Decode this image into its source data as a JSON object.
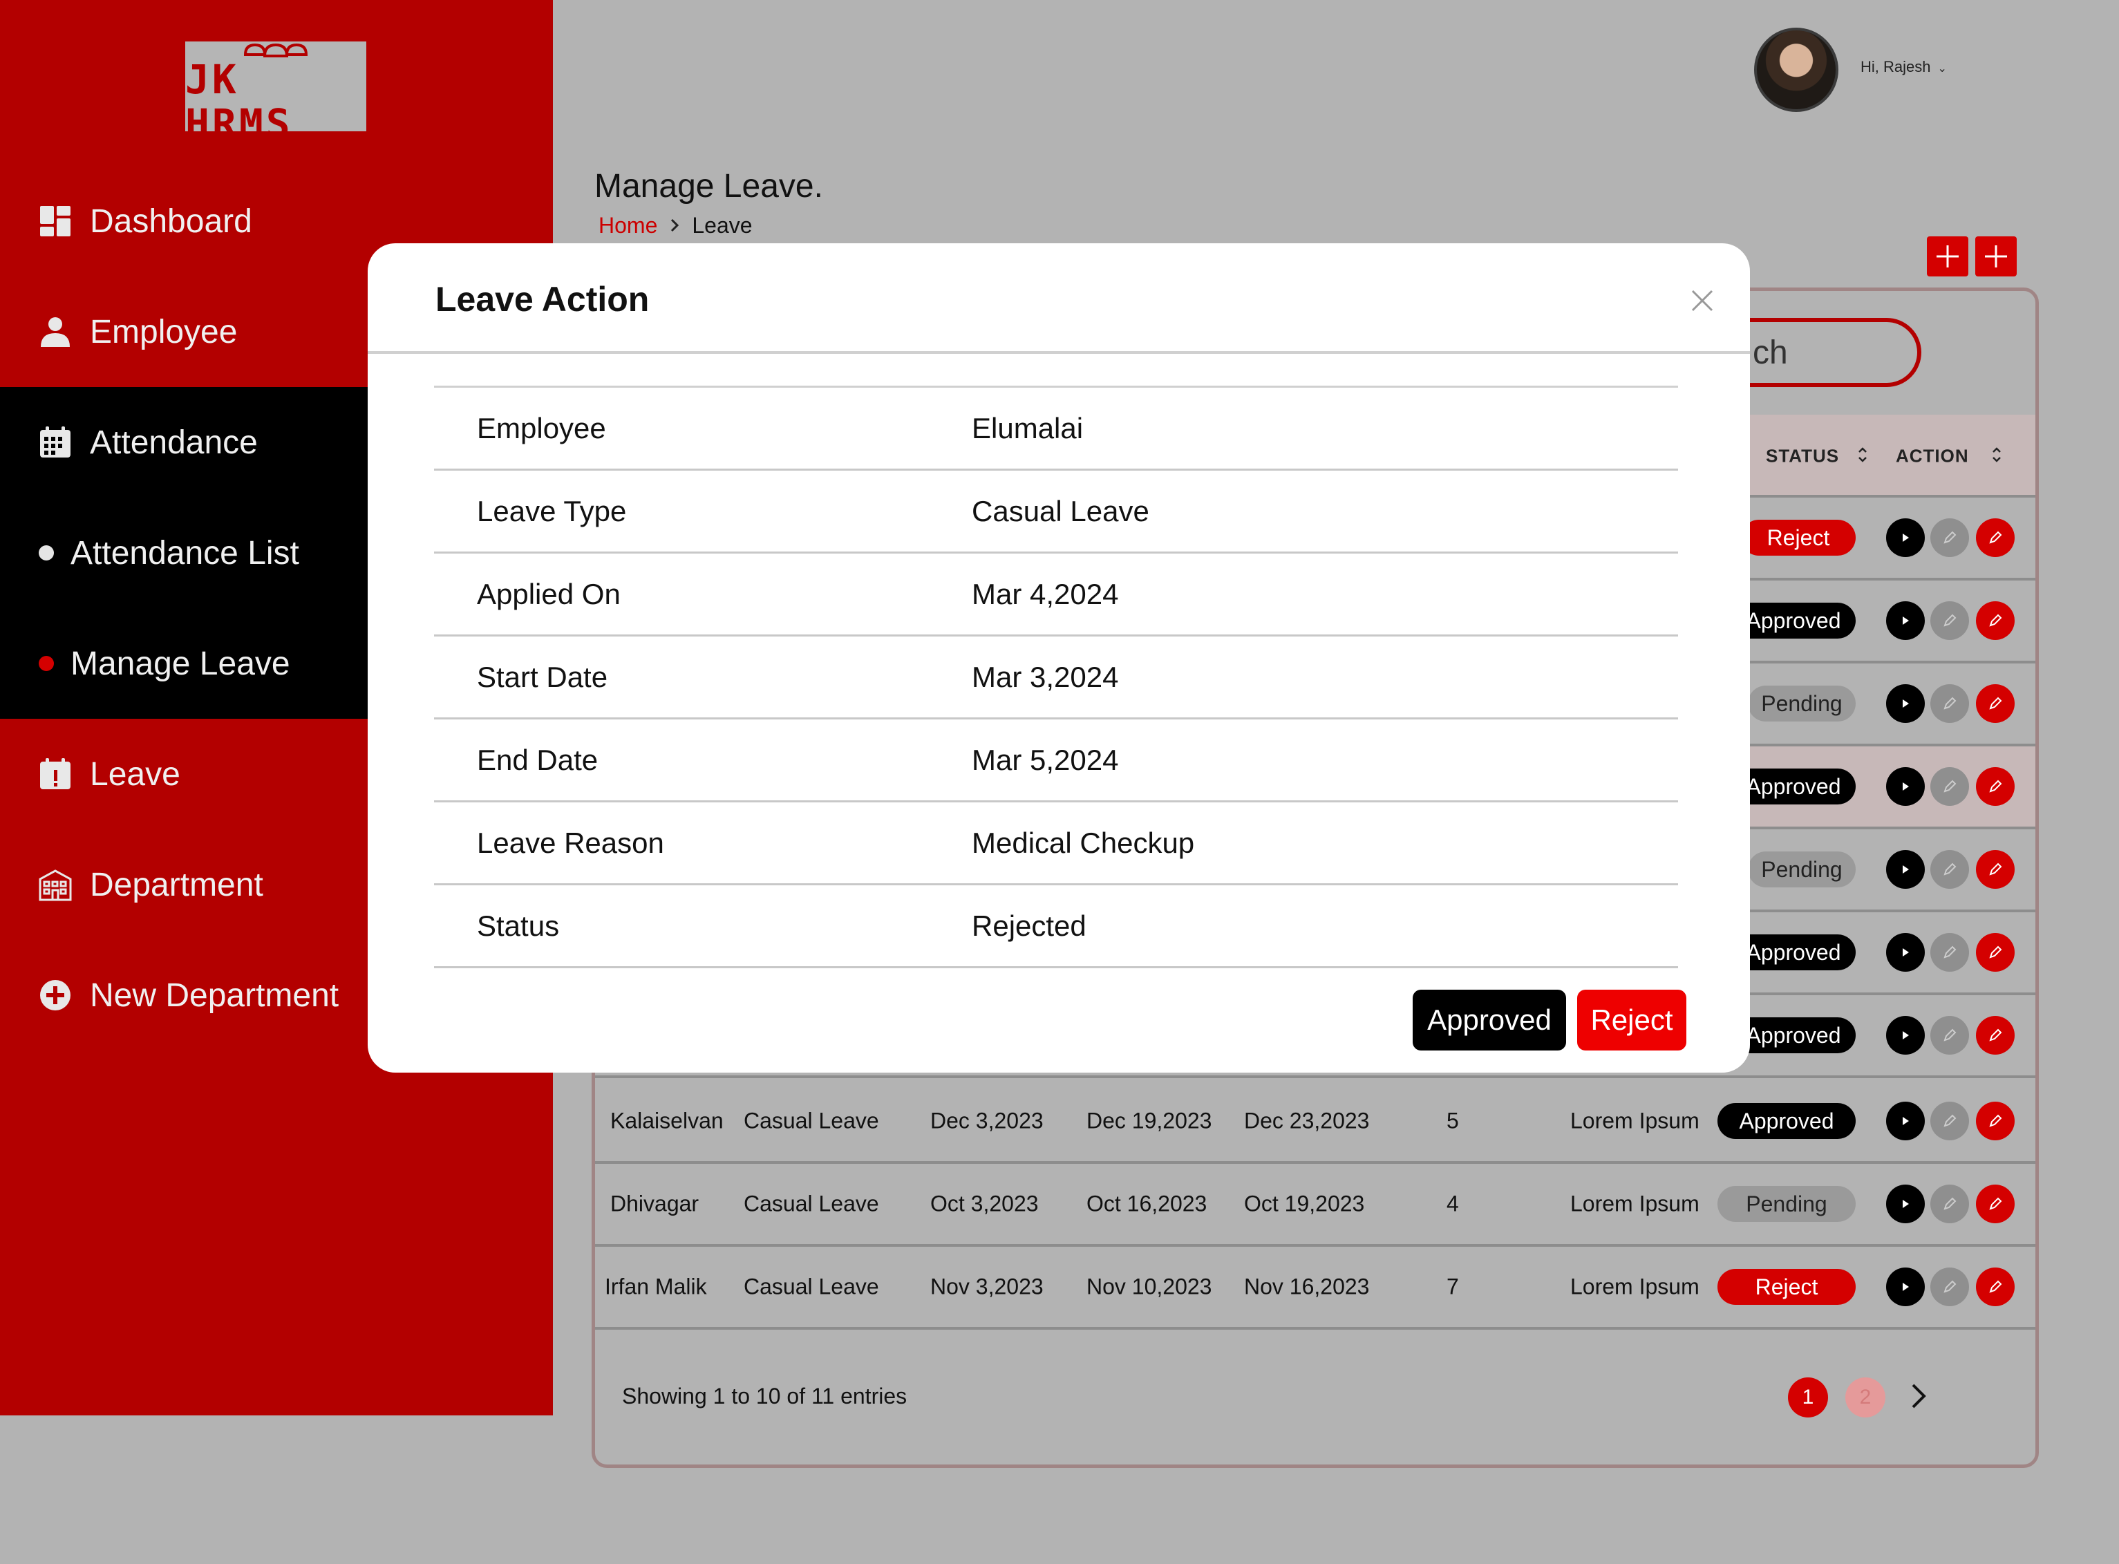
{
  "app": {
    "logo_text": "JK HRMS"
  },
  "sidebar": {
    "items": [
      {
        "label": "Dashboard",
        "icon": "dashboard-icon"
      },
      {
        "label": "Employee",
        "icon": "user-icon"
      },
      {
        "label": "Attendance",
        "icon": "calendar-grid-icon"
      },
      {
        "label": "Attendance List",
        "icon": "bullet-icon"
      },
      {
        "label": "Manage Leave",
        "icon": "bullet-icon"
      },
      {
        "label": "Leave",
        "icon": "calendar-alert-icon"
      },
      {
        "label": "Department",
        "icon": "building-icon"
      },
      {
        "label": "New Department",
        "icon": "plus-circle-icon"
      }
    ]
  },
  "header": {
    "greeting": "Hi, Rajesh"
  },
  "page": {
    "title": "Manage Leave.",
    "breadcrumb": {
      "home": "Home",
      "current": "Leave"
    }
  },
  "search": {
    "visible_text": "ch"
  },
  "table": {
    "headers": {
      "status": "STATUS",
      "action": "ACTION"
    },
    "rows": [
      {
        "name": "Kalaiselvan",
        "type": "Casual Leave",
        "applied": "Dec 3,2023",
        "start": "Dec 19,2023",
        "end": "Dec 23,2023",
        "days": "5",
        "reason": "Lorem Ipsum",
        "status": "Approved"
      },
      {
        "name": "Dhivagar",
        "type": "Casual Leave",
        "applied": "Oct 3,2023",
        "start": "Oct 16,2023",
        "end": "Oct 19,2023",
        "days": "4",
        "reason": "Lorem Ipsum",
        "status": "Pending"
      },
      {
        "name": "Irfan Malik",
        "type": "Casual Leave",
        "applied": "Nov 3,2023",
        "start": "Nov 10,2023",
        "end": "Nov 16,2023",
        "days": "7",
        "reason": "Lorem Ipsum",
        "status": "Reject"
      }
    ],
    "hidden_rows_status": [
      "Reject",
      "Approved",
      "Pending",
      "Approved",
      "Pending",
      "Approved",
      "Approved"
    ],
    "footer": "Showing 1 to 10 of 11 entries",
    "pages": [
      "1",
      "2"
    ]
  },
  "modal": {
    "title": "Leave Action",
    "fields": [
      {
        "label": "Employee",
        "value": "Elumalai"
      },
      {
        "label": "Leave Type",
        "value": "Casual Leave"
      },
      {
        "label": "Applied On",
        "value": "Mar 4,2024"
      },
      {
        "label": "Start Date",
        "value": "Mar 3,2024"
      },
      {
        "label": "End Date",
        "value": "Mar 5,2024"
      },
      {
        "label": "Leave Reason",
        "value": "Medical Checkup"
      },
      {
        "label": "Status",
        "value": "Rejected"
      }
    ],
    "approve_label": "Approved",
    "reject_label": "Reject"
  },
  "colors": {
    "brand_red": "#b30000",
    "accent_red": "#d40000",
    "overlay_gray": "#b3b3b3"
  }
}
